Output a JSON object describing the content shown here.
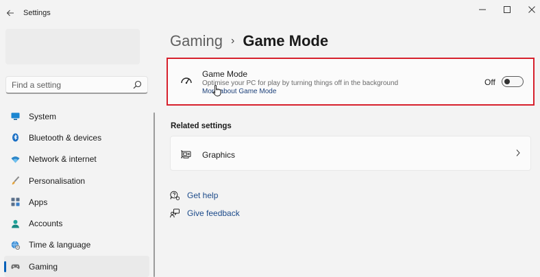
{
  "window": {
    "title": "Settings",
    "controls": {
      "minimize": "—",
      "maximize": "☐",
      "close": "✕"
    }
  },
  "search": {
    "placeholder": "Find a setting",
    "value": ""
  },
  "sidebar": {
    "items": [
      {
        "label": "System",
        "icon": "monitor-icon",
        "active": false
      },
      {
        "label": "Bluetooth & devices",
        "icon": "bluetooth-icon",
        "active": false
      },
      {
        "label": "Network & internet",
        "icon": "wifi-icon",
        "active": false
      },
      {
        "label": "Personalisation",
        "icon": "brush-icon",
        "active": false
      },
      {
        "label": "Apps",
        "icon": "apps-icon",
        "active": false
      },
      {
        "label": "Accounts",
        "icon": "person-icon",
        "active": false
      },
      {
        "label": "Time & language",
        "icon": "globe-clock-icon",
        "active": false
      },
      {
        "label": "Gaming",
        "icon": "gamepad-icon",
        "active": true
      }
    ]
  },
  "breadcrumb": {
    "parent": "Gaming",
    "separator": "›",
    "current": "Game Mode"
  },
  "game_mode": {
    "title": "Game Mode",
    "description": "Optimise your PC for play by turning things off in the background",
    "link": "More about Game Mode",
    "state_label": "Off",
    "enabled": false
  },
  "related": {
    "heading": "Related settings",
    "items": [
      {
        "label": "Graphics",
        "icon": "graphics-card-icon"
      }
    ]
  },
  "help": {
    "get_help": "Get help",
    "give_feedback": "Give feedback"
  },
  "colors": {
    "accent": "#005fb8",
    "highlight_border": "#d61f2b",
    "link": "#1b4a8a",
    "background": "#f3f3f3"
  }
}
